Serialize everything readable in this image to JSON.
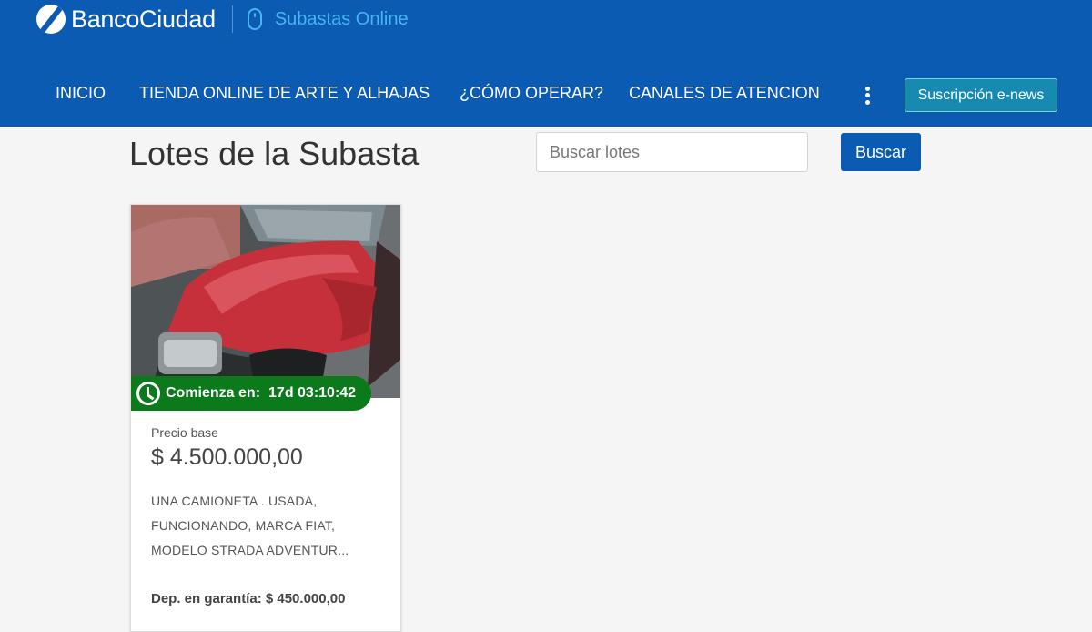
{
  "header": {
    "brand_name": "BancoCiudad",
    "brand_subtitle": "Subastas Online",
    "colors": {
      "primary": "#0a5bb1",
      "accent": "#49b4f2"
    },
    "nav": [
      {
        "label": "INICIO"
      },
      {
        "label": "TIENDA ONLINE DE ARTE Y ALHAJAS"
      },
      {
        "label": "¿CÓMO OPERAR?"
      },
      {
        "label": "CANALES DE ATENCION"
      }
    ],
    "more_icon": "kebab-menu-icon",
    "enews_button": "Suscripción e-news"
  },
  "main": {
    "title": "Lotes de la Subasta",
    "search": {
      "placeholder": "Buscar lotes",
      "value": "",
      "button": "Buscar"
    }
  },
  "lots": [
    {
      "photo": "red pickup truck hood",
      "countdown_label": "Comienza en:",
      "countdown_value": "17d 03:10:42",
      "countdown_color": "#0b7a1b",
      "price_label": "Precio base",
      "price": "$ 4.500.000,00",
      "description": "UNA CAMIONETA . USADA, FUNCIONANDO, MARCA FIAT, MODELO STRADA ADVENTUR...",
      "deposit": "Dep. en garantía: $ 450.000,00"
    }
  ]
}
